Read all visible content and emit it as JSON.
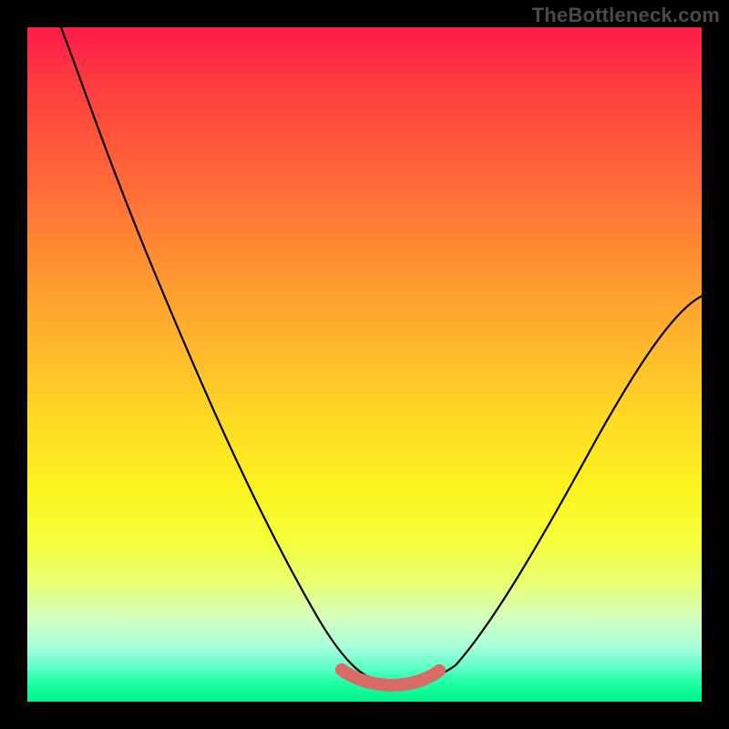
{
  "watermark": "TheBottleneck.com",
  "chart_data": {
    "type": "line",
    "title": "",
    "xlabel": "",
    "ylabel": "",
    "xlim": [
      0,
      100
    ],
    "ylim": [
      0,
      100
    ],
    "x": [
      5,
      10,
      15,
      20,
      25,
      30,
      35,
      40,
      45,
      48,
      50,
      52,
      55,
      58,
      60,
      65,
      70,
      75,
      80,
      85,
      90,
      95,
      100
    ],
    "values": [
      100,
      95,
      88,
      80,
      70,
      59,
      48,
      36,
      22,
      12,
      6,
      3,
      2,
      2,
      3,
      8,
      16,
      25,
      33,
      41,
      48,
      54,
      60
    ],
    "series": [
      {
        "name": "bottleneck-curve",
        "color": "#000000",
        "x": [
          5,
          10,
          15,
          20,
          25,
          30,
          35,
          40,
          45,
          48,
          50,
          52,
          55,
          58,
          60,
          65,
          70,
          75,
          80,
          85,
          90,
          95,
          100
        ],
        "values": [
          100,
          95,
          88,
          80,
          70,
          59,
          48,
          36,
          22,
          12,
          6,
          3,
          2,
          2,
          3,
          8,
          16,
          25,
          33,
          41,
          48,
          54,
          60
        ]
      },
      {
        "name": "optimal-band",
        "color": "#d96a66",
        "x": [
          50,
          52,
          55,
          58,
          60
        ],
        "values": [
          3,
          2,
          2,
          2,
          3
        ]
      }
    ],
    "colors": {
      "curve": "#000000",
      "optimal_band": "#d96a66",
      "gradient_top": "#ff1b4a",
      "gradient_bottom": "#00f58a"
    }
  }
}
